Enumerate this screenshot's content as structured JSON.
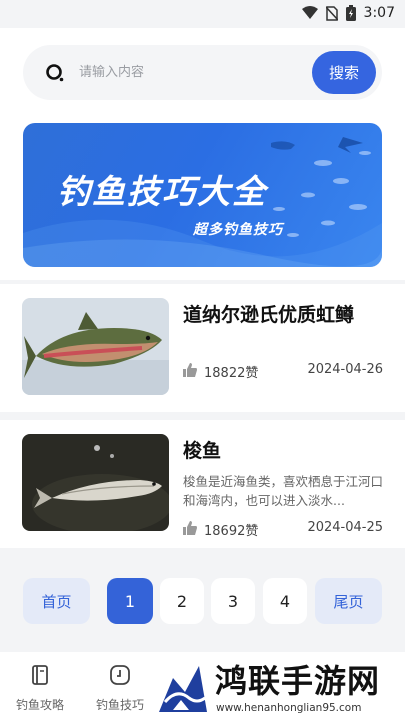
{
  "status_bar": {
    "time": "3:07",
    "icons": [
      "wifi-icon",
      "no-sim-icon",
      "battery-charging-icon"
    ]
  },
  "search": {
    "placeholder": "请输入内容",
    "button_label": "搜索"
  },
  "banner": {
    "title": "钓鱼技巧大全",
    "subtitle": "超多钓鱼技巧"
  },
  "articles": [
    {
      "title": "道纳尔逊氏优质虹鳟",
      "description": "",
      "likes": "18822赞",
      "date": "2024-04-26",
      "thumbnail": "rainbow-trout-image"
    },
    {
      "title": "梭鱼",
      "description": "梭鱼是近海鱼类，喜欢栖息于江河口和海湾内，也可以进入淡水...",
      "likes": "18692赞",
      "date": "2024-04-25",
      "thumbnail": "mullet-fish-image"
    }
  ],
  "pagination": {
    "first": "首页",
    "last": "尾页",
    "pages": [
      "1",
      "2",
      "3",
      "4"
    ],
    "current": "1"
  },
  "tabs": [
    {
      "label": "钓鱼攻略",
      "icon": "book-icon"
    },
    {
      "label": "钓鱼技巧",
      "icon": "clock-icon"
    }
  ],
  "watermark": {
    "text": "鸿联手游网",
    "url": "www.henanhonglian95.com"
  },
  "colors": {
    "accent": "#3463d8",
    "banner": "#2f6fd8",
    "page_edge_bg": "#e4eaf8"
  }
}
